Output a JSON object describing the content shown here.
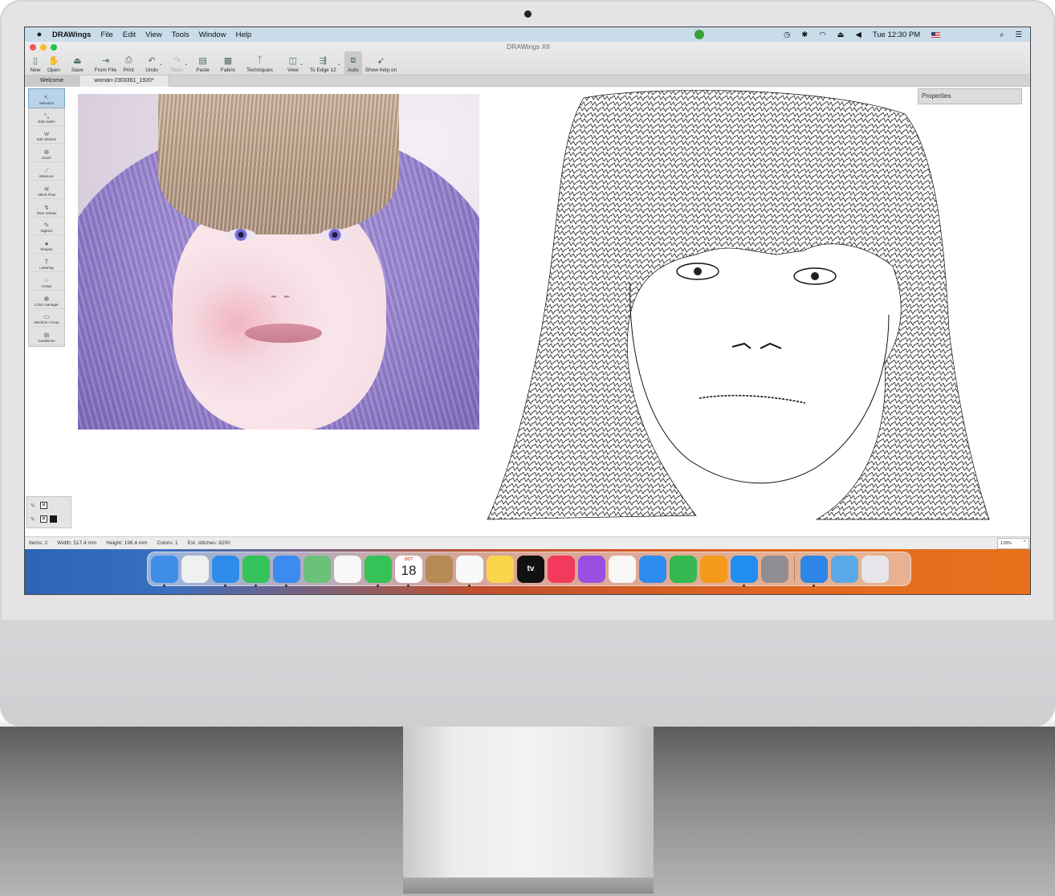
{
  "menubar": {
    "app_name": "DRAWings",
    "menus": [
      "File",
      "Edit",
      "View",
      "Tools",
      "Window",
      "Help"
    ],
    "clock": "Tue 12:30 PM"
  },
  "window": {
    "title": "DRAWings XII"
  },
  "toolbar": {
    "items": [
      {
        "label": "New",
        "icon": "new-doc-icon",
        "glyph": "▯"
      },
      {
        "label": "Open",
        "icon": "open-icon",
        "glyph": "✋"
      },
      {
        "label": "Save",
        "icon": "save-icon",
        "glyph": "⏏"
      },
      {
        "label": "From File",
        "icon": "from-file-icon",
        "glyph": "⇥"
      },
      {
        "label": "Print",
        "icon": "print-icon",
        "glyph": "⎙"
      },
      {
        "label": "Undo",
        "icon": "undo-icon",
        "glyph": "↶"
      },
      {
        "label": "Redo",
        "icon": "redo-icon",
        "glyph": "↷"
      },
      {
        "label": "Paste",
        "icon": "paste-icon",
        "glyph": "▤"
      },
      {
        "label": "Fabric",
        "icon": "fabric-icon",
        "glyph": "▦"
      },
      {
        "label": "Techniques",
        "icon": "techniques-icon",
        "glyph": "ᛉ"
      },
      {
        "label": "View",
        "icon": "view-icon",
        "glyph": "◫"
      },
      {
        "label": "To Edge 12",
        "icon": "to-edge-icon",
        "glyph": "⇶"
      },
      {
        "label": "Auto",
        "icon": "auto-icon",
        "glyph": "⧈"
      },
      {
        "label": "Show help on",
        "icon": "help-pointer-icon",
        "glyph": "➹"
      }
    ]
  },
  "tabs": [
    {
      "label": "Welcome"
    },
    {
      "label": "woman-2303361_1920*"
    }
  ],
  "tools": [
    {
      "label": "Selection",
      "icon": "selection-icon",
      "glyph": "↖"
    },
    {
      "label": "Edit nodes",
      "icon": "edit-nodes-icon",
      "glyph": "⤡"
    },
    {
      "label": "Edit stitches",
      "icon": "edit-stitches-icon",
      "glyph": "ᴡ"
    },
    {
      "label": "Zoom",
      "icon": "zoom-icon",
      "glyph": "⊕"
    },
    {
      "label": "Measure",
      "icon": "measure-icon",
      "glyph": "⟋"
    },
    {
      "label": "Stitch Flow",
      "icon": "stitch-flow-icon",
      "glyph": "≋"
    },
    {
      "label": "Slow redraw",
      "icon": "slow-redraw-icon",
      "glyph": "↯"
    },
    {
      "label": "Digitize",
      "icon": "digitize-icon",
      "glyph": "✎"
    },
    {
      "label": "Shapes",
      "icon": "shapes-icon",
      "glyph": "●"
    },
    {
      "label": "Lettering",
      "icon": "lettering-icon",
      "glyph": "T"
    },
    {
      "label": "Arrays",
      "icon": "arrays-icon",
      "glyph": "⁘"
    },
    {
      "label": "Color manager",
      "icon": "palette-icon",
      "glyph": "❁"
    },
    {
      "label": "Machine / Hoop",
      "icon": "hoop-icon",
      "glyph": "▭"
    },
    {
      "label": "Guidelines",
      "icon": "guidelines-icon",
      "glyph": "⊞"
    }
  ],
  "properties": {
    "label": "Properties"
  },
  "status": {
    "items": "Items: 2",
    "width": "Width: 517,4 mm",
    "height": "Height: 198,4 mm",
    "colors": "Colors: 1",
    "stitches": "Est. stitches: 8200",
    "zoom": "128%"
  },
  "dock": {
    "calendar_month": "OCT",
    "calendar_day": "18",
    "tv_label": "tv",
    "apps": [
      {
        "name": "finder-icon",
        "color": "#3c8ee6"
      },
      {
        "name": "launchpad-icon",
        "color": "#f0f0f0"
      },
      {
        "name": "safari-icon",
        "color": "#2f8bea"
      },
      {
        "name": "messages-icon",
        "color": "#36c25a"
      },
      {
        "name": "mail-icon",
        "color": "#3b8bf0"
      },
      {
        "name": "maps-icon",
        "color": "#6cc17a"
      },
      {
        "name": "photos-icon",
        "color": "#f7f7f7"
      },
      {
        "name": "facetime-icon",
        "color": "#35c257"
      },
      {
        "name": "calendar-icon",
        "color": "#ffffff"
      },
      {
        "name": "contacts-icon",
        "color": "#b58a55"
      },
      {
        "name": "reminders-icon",
        "color": "#f9f9f9"
      },
      {
        "name": "notes-icon",
        "color": "#fbd54a"
      },
      {
        "name": "tv-icon",
        "color": "#111111"
      },
      {
        "name": "music-icon",
        "color": "#f23b5c"
      },
      {
        "name": "podcasts-icon",
        "color": "#9b4fe0"
      },
      {
        "name": "news-icon",
        "color": "#f7f7f7"
      },
      {
        "name": "keynote-icon",
        "color": "#2d8cf0"
      },
      {
        "name": "numbers-icon",
        "color": "#34b84f"
      },
      {
        "name": "pages-icon",
        "color": "#f39a1c"
      },
      {
        "name": "app-store-icon",
        "color": "#1f8ef3"
      },
      {
        "name": "system-preferences-icon",
        "color": "#8e8e93"
      },
      {
        "name": "weather-icon",
        "color": "#2d86e8"
      },
      {
        "name": "downloads-folder-icon",
        "color": "#5aa9e6"
      },
      {
        "name": "trash-icon",
        "color": "#e6e6ea"
      }
    ]
  }
}
